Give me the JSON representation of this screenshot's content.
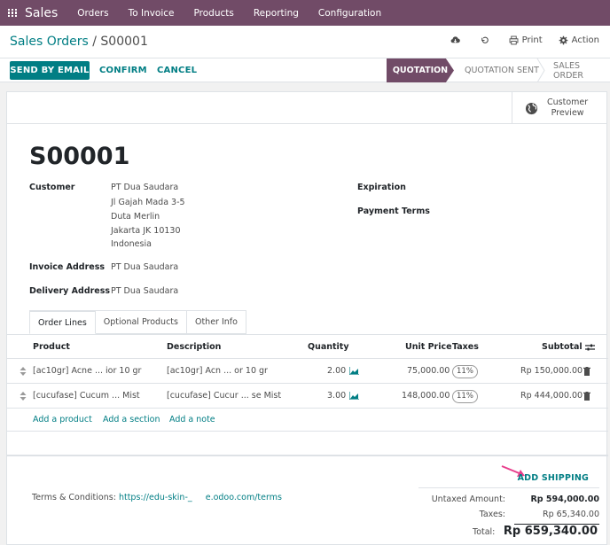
{
  "topnav": {
    "app_name": "Sales",
    "menu": [
      "Orders",
      "To Invoice",
      "Products",
      "Reporting",
      "Configuration"
    ]
  },
  "breadcrumb": {
    "parent": "Sales Orders",
    "separator": "/",
    "current": "S00001"
  },
  "cp_actions": {
    "print": "Print",
    "action": "Action"
  },
  "buttons": {
    "send_by_email": "SEND BY EMAIL",
    "confirm": "CONFIRM",
    "cancel": "CANCEL"
  },
  "stages": {
    "active": "QUOTATION",
    "next": "QUOTATION SENT",
    "last": "SALES ORDER"
  },
  "smart_button": {
    "line1": "Customer",
    "line2": "Preview"
  },
  "record": {
    "title": "S00001",
    "customer_label": "Customer",
    "customer_lines": [
      "PT Dua Saudara",
      "Jl Gajah Mada 3-5",
      "Duta Merlin",
      "Jakarta JK 10130",
      "Indonesia"
    ],
    "invoice_address_label": "Invoice Address",
    "invoice_address": "PT Dua Saudara",
    "delivery_address_label": "Delivery Address",
    "delivery_address": "PT Dua Saudara",
    "expiration_label": "Expiration",
    "payment_terms_label": "Payment Terms"
  },
  "tabs": [
    "Order Lines",
    "Optional Products",
    "Other Info"
  ],
  "table": {
    "headers": {
      "product": "Product",
      "description": "Description",
      "quantity": "Quantity",
      "unit_price": "Unit Price",
      "taxes": "Taxes",
      "subtotal": "Subtotal"
    },
    "rows": [
      {
        "product": "[ac10gr] Acne ... ior 10 gr",
        "description": "[ac10gr] Acn ... or 10 gr",
        "quantity": "2.00",
        "unit_price": "75,000.00",
        "tax": "11%",
        "subtotal": "Rp 150,000.00"
      },
      {
        "product": "[cucufase] Cucum ... Mist",
        "description": "[cucufase] Cucur ... se Mist",
        "quantity": "3.00",
        "unit_price": "148,000.00",
        "tax": "11%",
        "subtotal": "Rp 444,000.00"
      }
    ],
    "add_links": [
      "Add a product",
      "Add a section",
      "Add a note"
    ]
  },
  "footer": {
    "add_shipping": "ADD SHIPPING",
    "terms_label": "Terms & Conditions:",
    "terms_link": "https://edu-skin-_     e.odoo.com/terms",
    "untaxed_label": "Untaxed Amount:",
    "untaxed_value": "Rp 594,000.00",
    "taxes_label": "Taxes:",
    "taxes_value": "Rp 65,340.00",
    "total_label": "Total:",
    "total_value": "Rp 659,340.00"
  },
  "colors": {
    "brand": "#714b67",
    "accent": "#017e84",
    "arrow": "#e83e8c"
  }
}
